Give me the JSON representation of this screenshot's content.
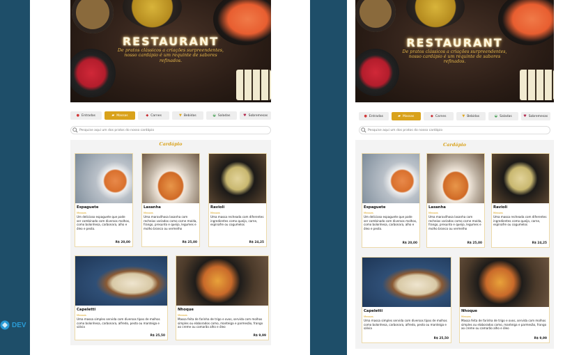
{
  "hero": {
    "title": "RESTAURANT",
    "subtitle_line1": "De pratos clássicos a criações surpreendentes,",
    "subtitle_line2": "nosso cardápio é um requinte de sabores",
    "subtitle_line3": "refinados."
  },
  "tabs": [
    {
      "label": "Entradas",
      "icon": "salad-icon"
    },
    {
      "label": "Massas",
      "icon": "pasta-icon"
    },
    {
      "label": "Carnes",
      "icon": "meat-icon"
    },
    {
      "label": "Bebidas",
      "icon": "drink-icon"
    },
    {
      "label": "Saladas",
      "icon": "bowl-icon"
    },
    {
      "label": "Sobremesas",
      "icon": "dessert-icon"
    }
  ],
  "active_tab": "Massas",
  "search": {
    "placeholder": "Pesquise aqui um dos pratos do nosso cardápio"
  },
  "menu": {
    "title": "Cardápio"
  },
  "cards": [
    {
      "name": "Espaguete",
      "category": "Massas",
      "description": "Um delicioso espaguete que pode ser combinado com diversos molhos, como bolonhesa, carbonara, alho e óleo e pesto.",
      "price": "R$ 20,00"
    },
    {
      "name": "Lasanha",
      "category": "Massas",
      "description": "Uma maravilhosa lasanha com recheios variados como carne moída, frango, presunto e queijo, legumes e molho branco ou vermelho",
      "price": "R$ 25,00"
    },
    {
      "name": "Ravioli",
      "category": "Massas",
      "description": "Uma massa recheada com diferentes ingredientes como queijo, carne, espinafre ou cogumelos",
      "price": "R$ 24,25"
    },
    {
      "name": "Capeletti",
      "category": "Massas",
      "description": "Uma massa simples servida com diversos tipos de molhos como bolonhesa, carbonara, alfredo, pesto ou manteiga e sálvia",
      "price": "R$ 25,50"
    },
    {
      "name": "Nhoque",
      "category": "Massas",
      "description": "Massa feita de farinha de trigo e ovos, servida com molhos simples ou elaborados como, manteiga e parmesão, frango ao creme ou camarão alho e óleo",
      "price": "R$ 9,99"
    }
  ],
  "brand": {
    "name": "DEV"
  },
  "colors": {
    "accent": "#d9a21b",
    "background": "#1e4e69",
    "brand": "#2a9bd6"
  }
}
